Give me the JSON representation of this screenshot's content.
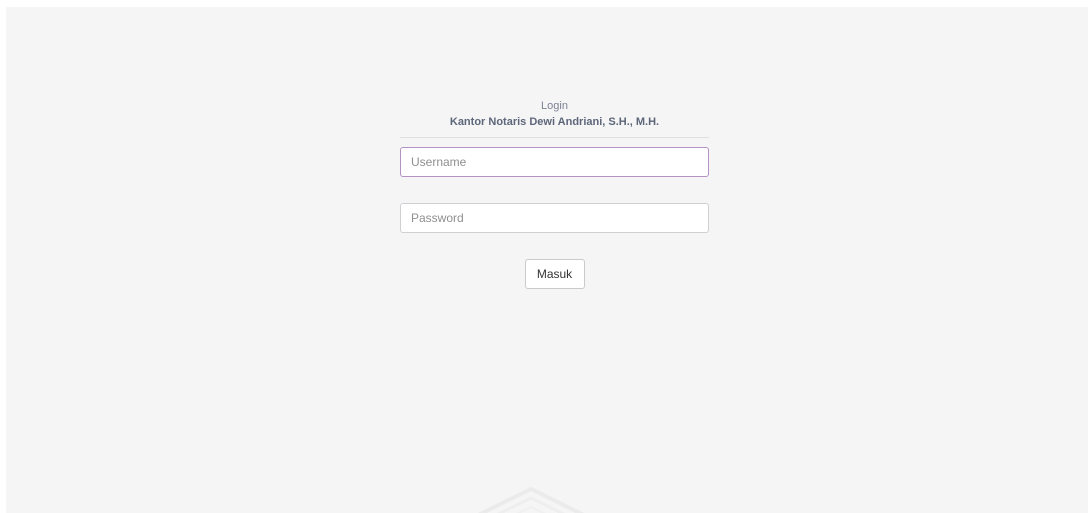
{
  "login": {
    "heading": "Login",
    "office_name": "Kantor Notaris Dewi Andriani, S.H., M.H.",
    "username": {
      "placeholder": "Username",
      "value": ""
    },
    "password": {
      "placeholder": "Password",
      "value": ""
    },
    "submit_label": "Masuk"
  },
  "colors": {
    "background": "#f5f5f6",
    "focused_border": "#b493c4",
    "heading_text": "#5d6679"
  },
  "icons": {
    "watermark": "watermark-logo-icon"
  }
}
